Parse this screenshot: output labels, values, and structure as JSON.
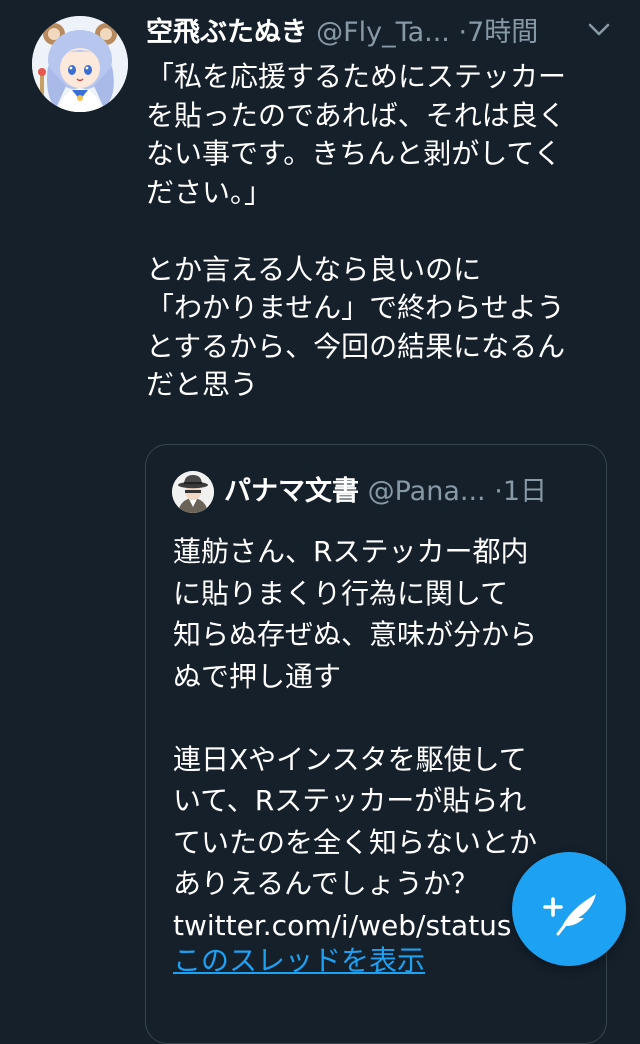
{
  "tweet": {
    "display_name": "空飛ぶたぬき",
    "handle": "@Fly_Ta...",
    "separator": "·",
    "time": "7時間",
    "body_lines": [
      "「私を応援するためにステッカー",
      "を貼ったのであれば、それは良く",
      "ない事です。きちんと剥がしてく",
      "ださい。」",
      "",
      "とか言える人なら良いのに",
      "「わかりません」で終わらせよう",
      "とするから、今回の結果になるん",
      "だと思う"
    ]
  },
  "quoted_tweet": {
    "display_name": "パナマ文書",
    "handle": "@Pana...",
    "separator": "·",
    "time": "1日",
    "body_lines": [
      "蓮舫さん、Rステッカー都内",
      "に貼りまくり行為に関して",
      "知らぬ存ぜぬ、意味が分から",
      "ぬで押し通す",
      "",
      "連日Xやインスタを駆使して",
      "いて、Rステッカーが貼られ",
      "ていたのを全く知らないとか",
      "ありえるんでしょうか？",
      "twitter.com/i/web/status"
    ],
    "thread_link": "このスレッドを表示"
  },
  "icons": {
    "caret": "chevron-down-icon",
    "compose": "compose-tweet-icon",
    "avatar": "anime-character-avatar",
    "quoted_avatar": "detective-avatar"
  },
  "colors": {
    "background": "#15202b",
    "secondary_text": "#8899a6",
    "accent": "#1da1f2",
    "border": "#38444d"
  }
}
